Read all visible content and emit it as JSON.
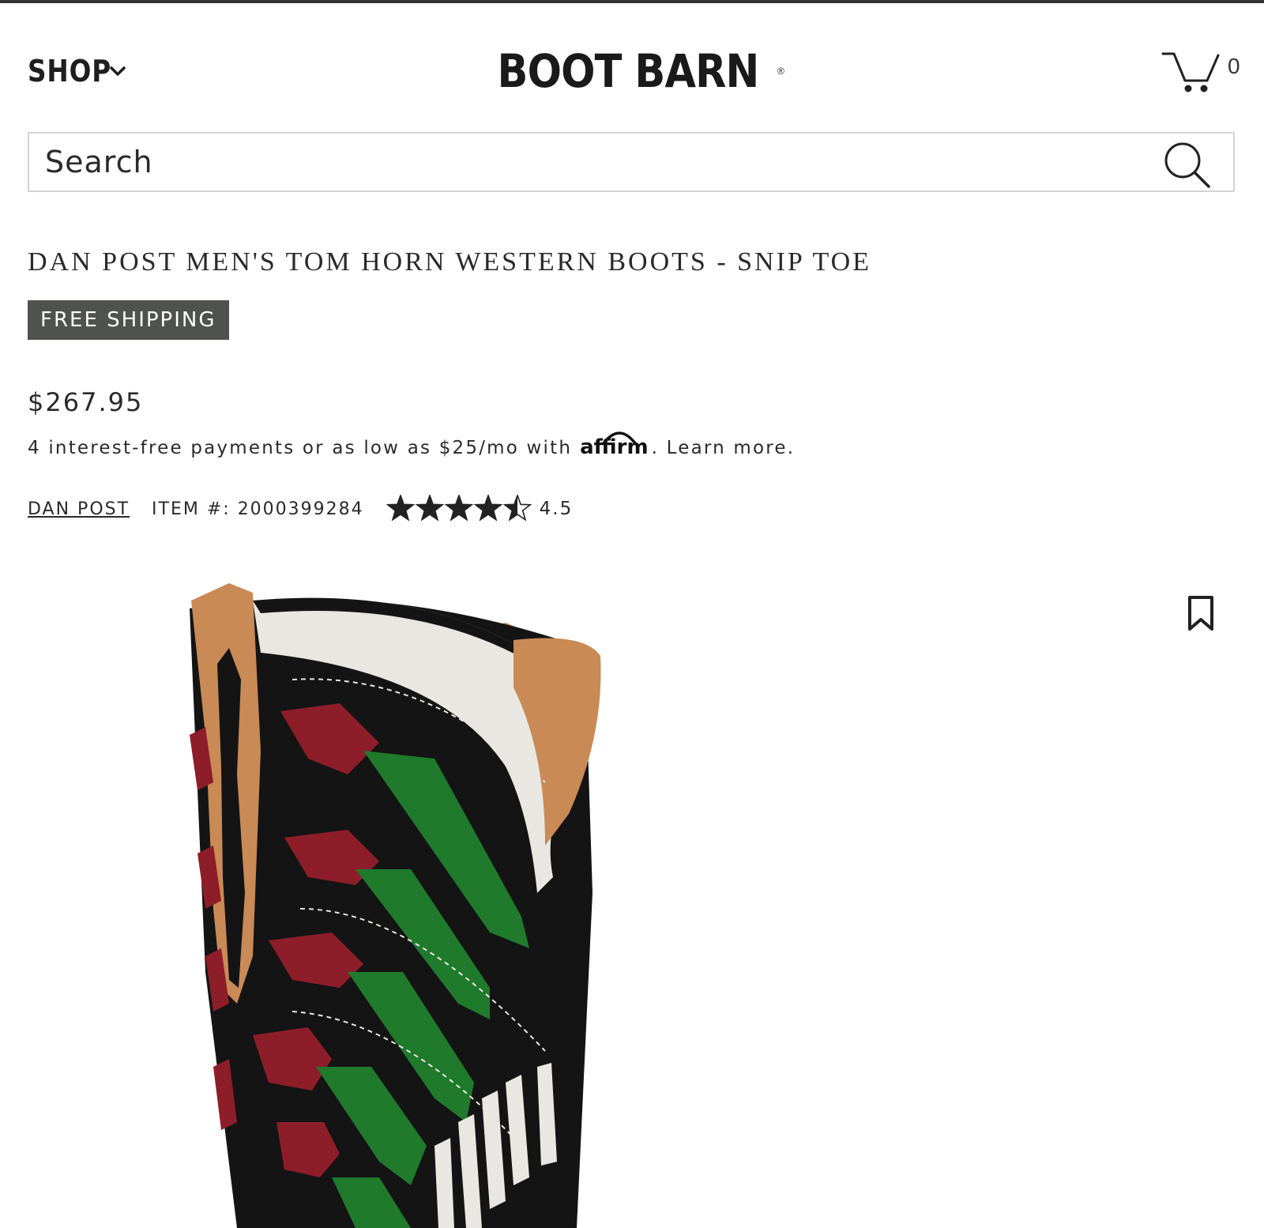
{
  "header": {
    "shop_label": "SHOP",
    "logo_text": "BOOT BARN",
    "cart_count": "0"
  },
  "search": {
    "placeholder": "Search"
  },
  "product": {
    "title": "DAN POST MEN'S TOM HORN WESTERN BOOTS - SNIP TOE",
    "badge": "FREE SHIPPING",
    "price": "$267.95",
    "financing_text": "4 interest-free payments or as low as $25/mo with",
    "financing_brand": "affirm",
    "financing_link": ". Learn more.",
    "brand": "DAN POST",
    "item_number": "ITEM #: 2000399284",
    "rating": "4.5",
    "rating_value": 4.5,
    "rating_max": 5
  },
  "colors": {
    "badge_bg": "#4f524f",
    "text": "#2a2a2a",
    "boot_black": "#141414",
    "boot_red": "#8e1d2a",
    "boot_green": "#1f7a2c",
    "boot_white": "#e9e7e1",
    "boot_tan": "#c98a55"
  },
  "icons": {
    "shop": "chevron-down-icon",
    "cart": "cart-icon",
    "search": "search-icon",
    "bookmark": "bookmark-icon",
    "rating": "star-icon"
  }
}
